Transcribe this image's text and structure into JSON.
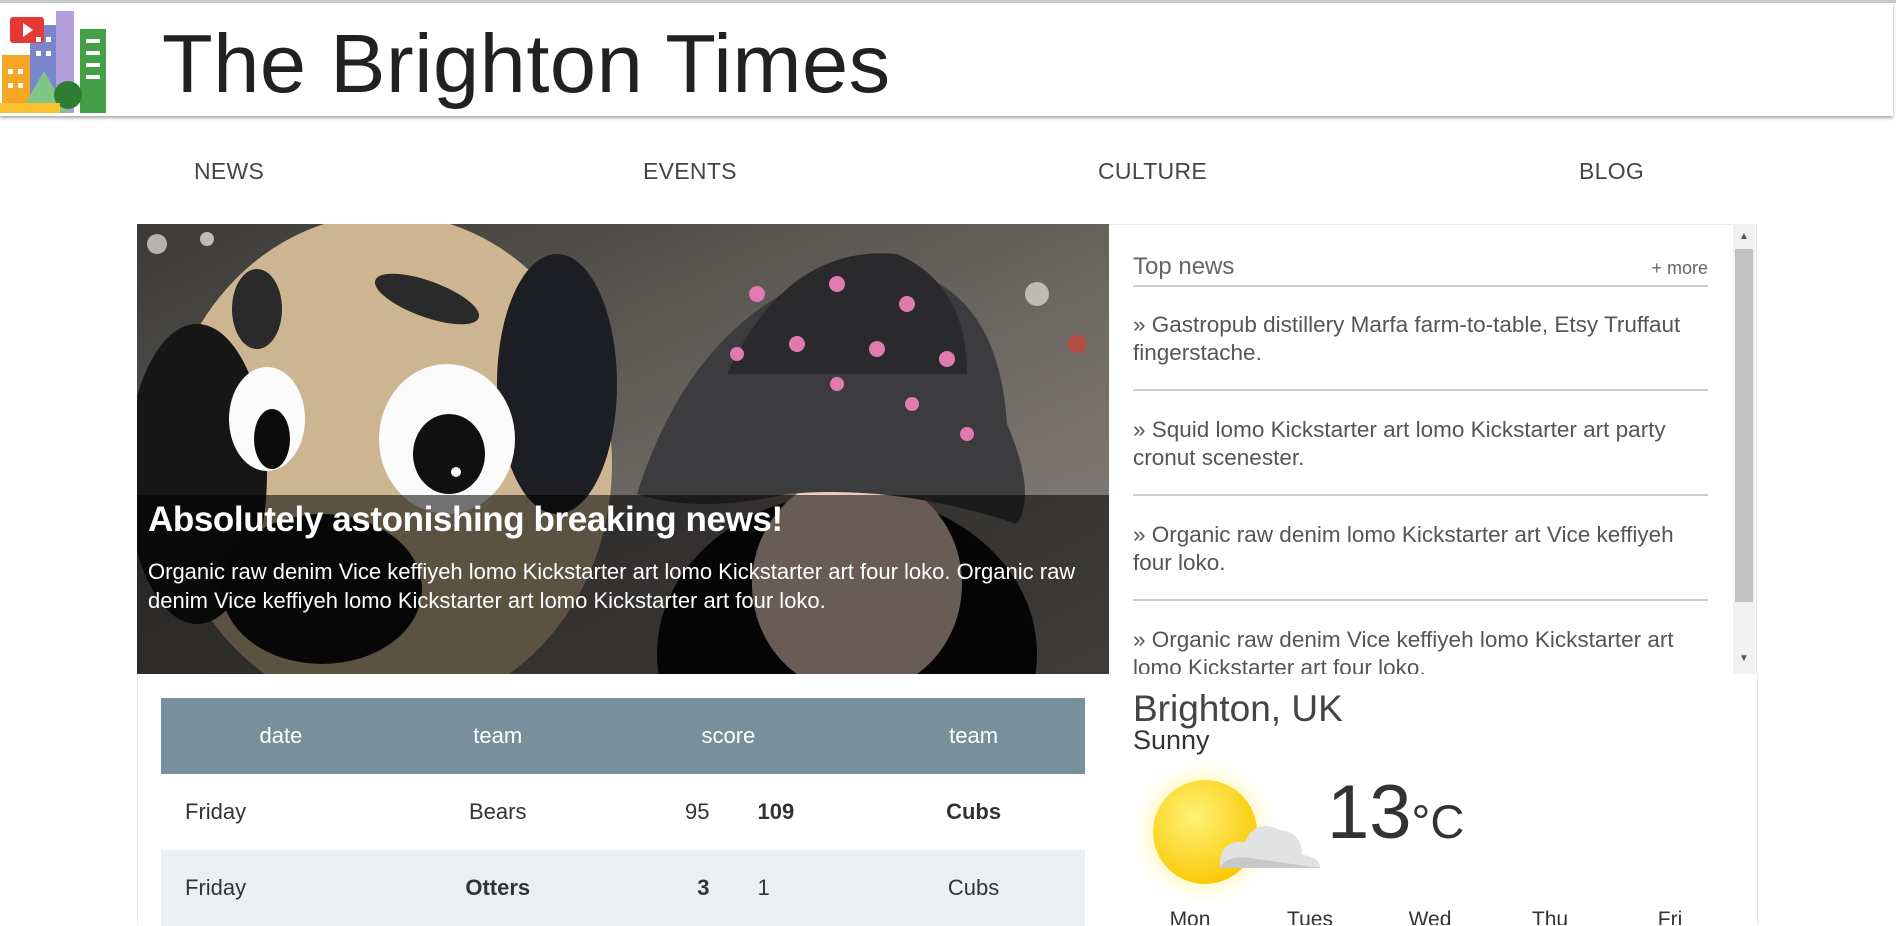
{
  "site": {
    "title": "The Brighton Times"
  },
  "nav": {
    "items": [
      "NEWS",
      "EVENTS",
      "CULTURE",
      "BLOG"
    ]
  },
  "hero": {
    "headline": "Absolutely astonishing breaking news!",
    "text": "Organic raw denim Vice keffiyeh lomo Kickstarter art lomo Kickstarter art four loko. Organic raw denim Vice keffiyeh lomo Kickstarter art lomo Kickstarter art four loko."
  },
  "top_news": {
    "title": "Top news",
    "more_label": "+ more",
    "items": [
      "» Gastropub distillery Marfa farm-to-table, Etsy Truffaut fingerstache.",
      "» Squid lomo Kickstarter art lomo Kickstarter art party cronut scenester.",
      "» Organic raw denim lomo Kickstarter art Vice keffiyeh four loko.",
      "» Organic raw denim Vice keffiyeh lomo Kickstarter art lomo Kickstarter art four loko."
    ]
  },
  "scores": {
    "headers": [
      "date",
      "team",
      "score",
      "team"
    ],
    "rows": [
      {
        "date": "Friday",
        "team1": "Bears",
        "score1": "95",
        "score2": "109",
        "team2": "Cubs"
      },
      {
        "date": "Friday",
        "team1": "Otters",
        "score1": "3",
        "score2": "1",
        "team2": "Cubs"
      }
    ]
  },
  "weather": {
    "city": "Brighton, UK",
    "condition": "Sunny",
    "temperature": "13",
    "unit": "°C",
    "icon": "sun-cloud-icon",
    "days": [
      "Mon",
      "Tues",
      "Wed",
      "Thu",
      "Fri"
    ]
  },
  "colors": {
    "table_header": "#78909c",
    "table_alt_row": "#eceff1",
    "title_text": "#212121"
  }
}
